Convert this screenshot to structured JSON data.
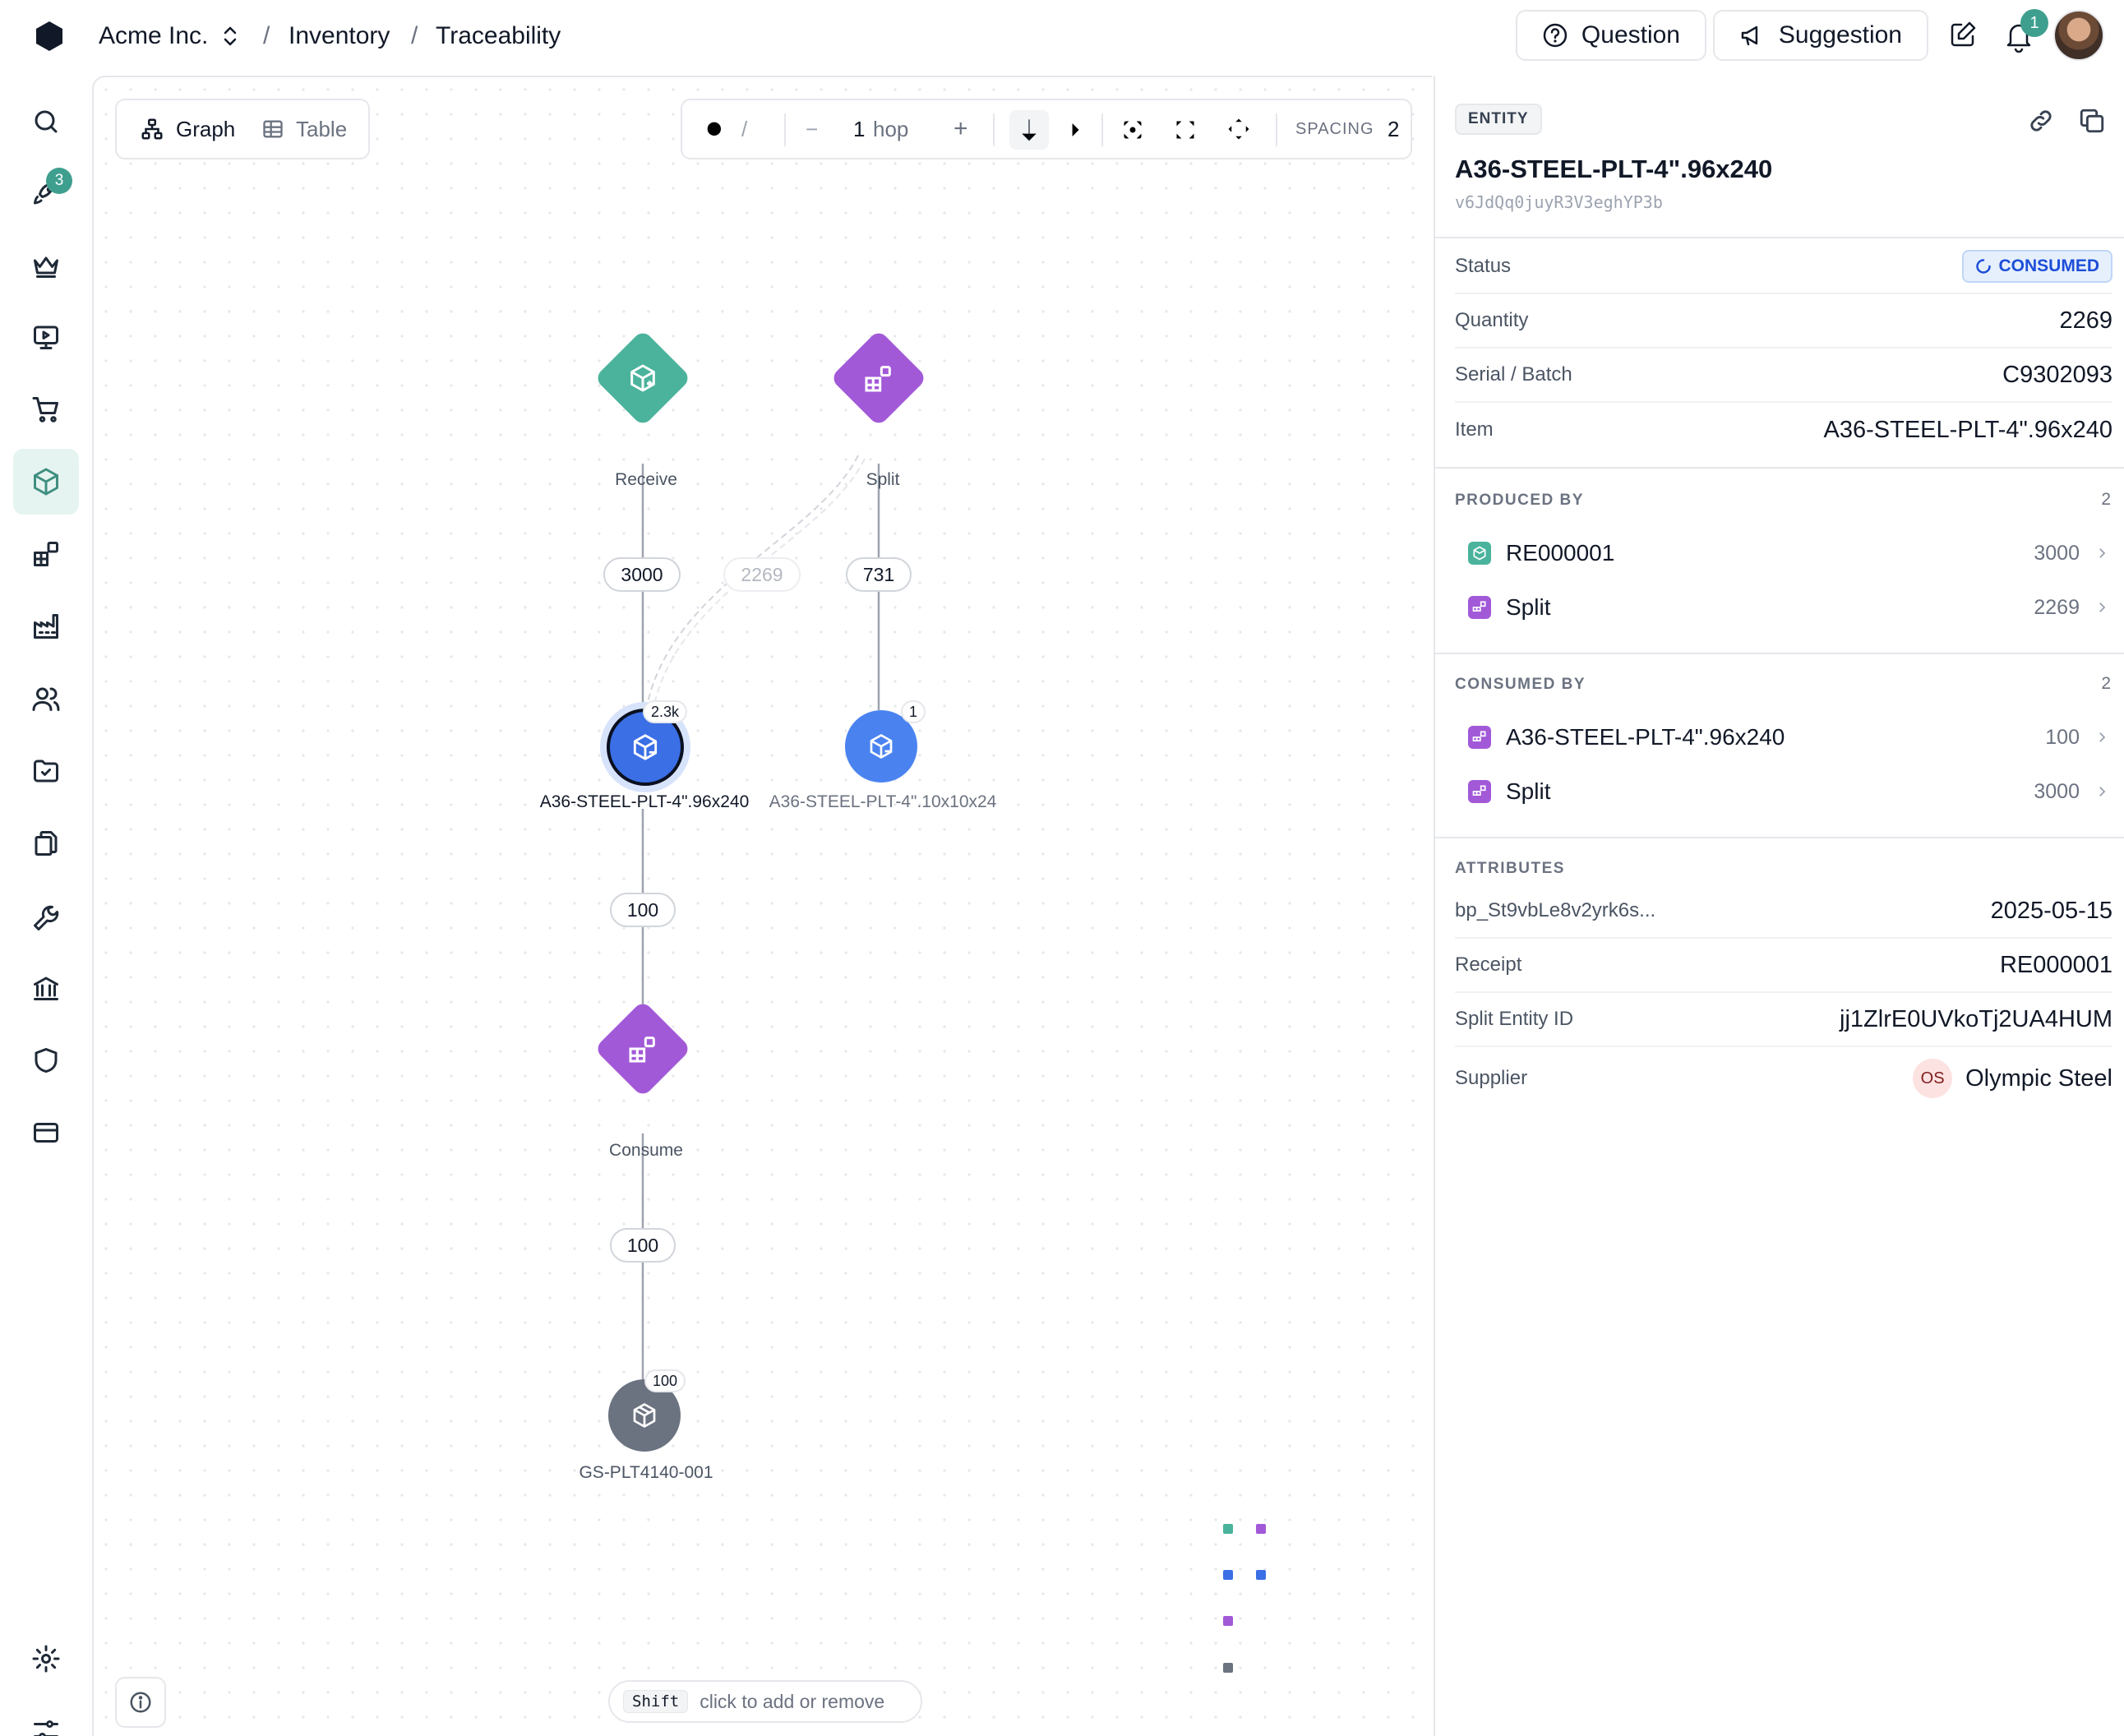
{
  "topbar": {
    "org": "Acme Inc.",
    "breadcrumb": [
      "Inventory",
      "Traceability"
    ],
    "question_label": "Question",
    "suggestion_label": "Suggestion",
    "notification_count": "1"
  },
  "sidebar": {
    "task_badge": "3",
    "items": [
      "search-icon",
      "rocket-icon",
      "crown-icon",
      "presentation-icon",
      "cart-icon",
      "cube-icon",
      "blocks-icon",
      "factory-icon",
      "users-icon",
      "folder-check-icon",
      "files-icon",
      "wrench-icon",
      "bank-icon",
      "shield-icon",
      "credit-card-icon",
      "settings-icon",
      "sliders-icon"
    ],
    "active": "cube-icon"
  },
  "view_toggle": {
    "graph_label": "Graph",
    "table_label": "Table",
    "active": "Graph"
  },
  "toolbar": {
    "search_shortcut": "/",
    "hop_value": "1",
    "hop_unit": "hop",
    "minus": "−",
    "plus": "+",
    "spacing_label": "SPACING",
    "spacing_value": "2"
  },
  "graph": {
    "nodes": {
      "receive": {
        "label": "Receive",
        "color": "#4bb39c"
      },
      "split_top": {
        "label": "Split",
        "color": "#a259d8"
      },
      "main_entity": {
        "label": "A36-STEEL-PLT-4\".96x240",
        "count": "2.3k",
        "color": "#3b6fe6"
      },
      "side_entity": {
        "label": "A36-STEEL-PLT-4\".10x10x24",
        "count": "1",
        "color": "#4a83f0"
      },
      "consume": {
        "label": "Consume",
        "color": "#a259d8"
      },
      "output": {
        "label": "GS-PLT4140-001",
        "count": "100",
        "color": "#6b7280"
      }
    },
    "edges": {
      "receive_main": "3000",
      "split_main": "2269",
      "split_side": "731",
      "main_consume": "100",
      "consume_output": "100"
    },
    "hint_key": "Shift",
    "hint_text": "click to add or remove"
  },
  "entity": {
    "type_label": "ENTITY",
    "name": "A36-STEEL-PLT-4\".96x240",
    "id": "v6JdQq0juyR3V3eghYP3b",
    "fields": [
      {
        "key": "Status",
        "value": "CONSUMED"
      },
      {
        "key": "Quantity",
        "value": "2269"
      },
      {
        "key": "Serial / Batch",
        "value": "C9302093"
      },
      {
        "key": "Item",
        "value": "A36-STEEL-PLT-4\".96x240"
      }
    ],
    "produced_by": {
      "title": "PRODUCED BY",
      "count": "2",
      "items": [
        {
          "name": "RE000001",
          "qty": "3000",
          "color": "#4bb39c"
        },
        {
          "name": "Split",
          "qty": "2269",
          "color": "#a259d8"
        }
      ]
    },
    "consumed_by": {
      "title": "CONSUMED BY",
      "count": "2",
      "items": [
        {
          "name": "A36-STEEL-PLT-4\".96x240",
          "qty": "100",
          "color": "#a259d8"
        },
        {
          "name": "Split",
          "qty": "3000",
          "color": "#a259d8"
        }
      ]
    },
    "attributes": {
      "title": "ATTRIBUTES",
      "items": [
        {
          "key": "bp_St9vbLe8v2yrk6s...",
          "value": "2025-05-15"
        },
        {
          "key": "Receipt",
          "value": "RE000001"
        },
        {
          "key": "Split Entity ID",
          "value": "jj1ZlrE0UVkoTj2UA4HUM"
        },
        {
          "key": "Supplier",
          "value": "Olympic Steel",
          "avatar": "OS"
        }
      ]
    }
  }
}
